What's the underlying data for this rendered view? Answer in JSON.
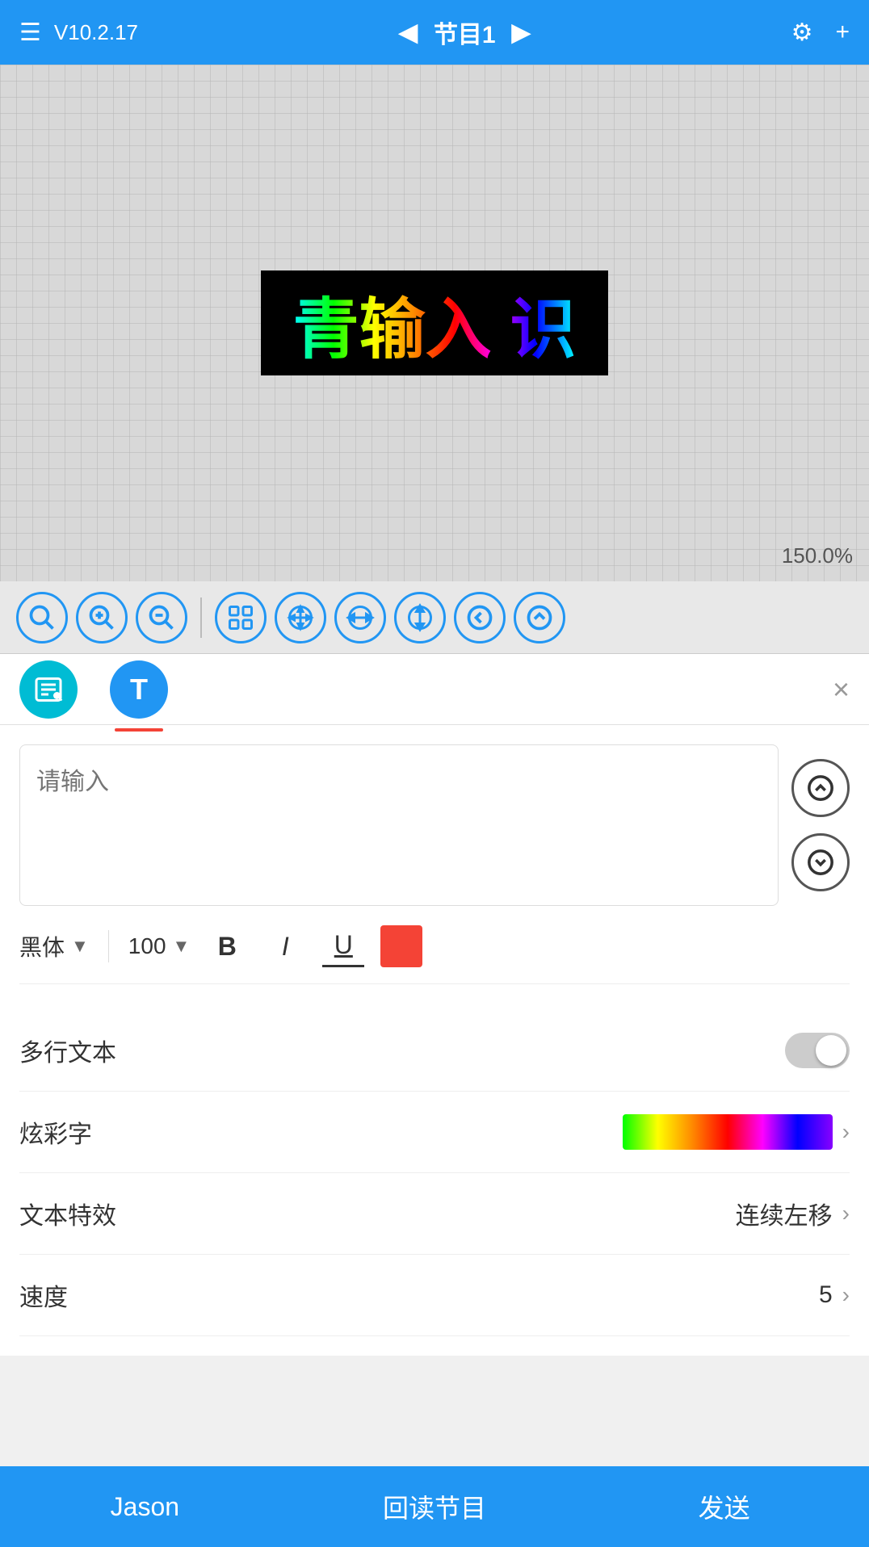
{
  "header": {
    "menu_label": "☰",
    "version": "V10.2.17",
    "prev_label": "◀",
    "title": "节目1",
    "next_label": "▶",
    "settings_label": "⚙",
    "add_label": "+"
  },
  "canvas": {
    "zoom": "150.0%",
    "led_text": "青输入 识"
  },
  "toolbar": {
    "tools": [
      {
        "name": "zoom-search",
        "icon": "🔍"
      },
      {
        "name": "zoom-in",
        "icon": "⊕"
      },
      {
        "name": "zoom-out",
        "icon": "⊖"
      },
      {
        "name": "grid",
        "icon": "⊞"
      },
      {
        "name": "move-all",
        "icon": "✥"
      },
      {
        "name": "move-h",
        "icon": "↔"
      },
      {
        "name": "move-v",
        "icon": "↕"
      },
      {
        "name": "arrow-left",
        "icon": "←"
      },
      {
        "name": "arrow-up",
        "icon": "↑"
      }
    ]
  },
  "tabs": {
    "settings_tab_label": "⚙",
    "text_tab_label": "T",
    "close_label": "×"
  },
  "text_panel": {
    "placeholder": "请输入",
    "up_arrow": "↑",
    "down_arrow": "↓"
  },
  "format": {
    "font_name": "黑体",
    "font_size": "100",
    "bold_label": "B",
    "italic_label": "I",
    "underline_label": "U",
    "color": "#f44336"
  },
  "settings": {
    "multiline_label": "多行文本",
    "rainbow_label": "炫彩字",
    "effect_label": "文本特效",
    "effect_value": "连续左移",
    "speed_label": "速度",
    "speed_value": "5"
  },
  "bottom": {
    "jason_label": "Jason",
    "read_label": "回读节目",
    "send_label": "发送"
  }
}
